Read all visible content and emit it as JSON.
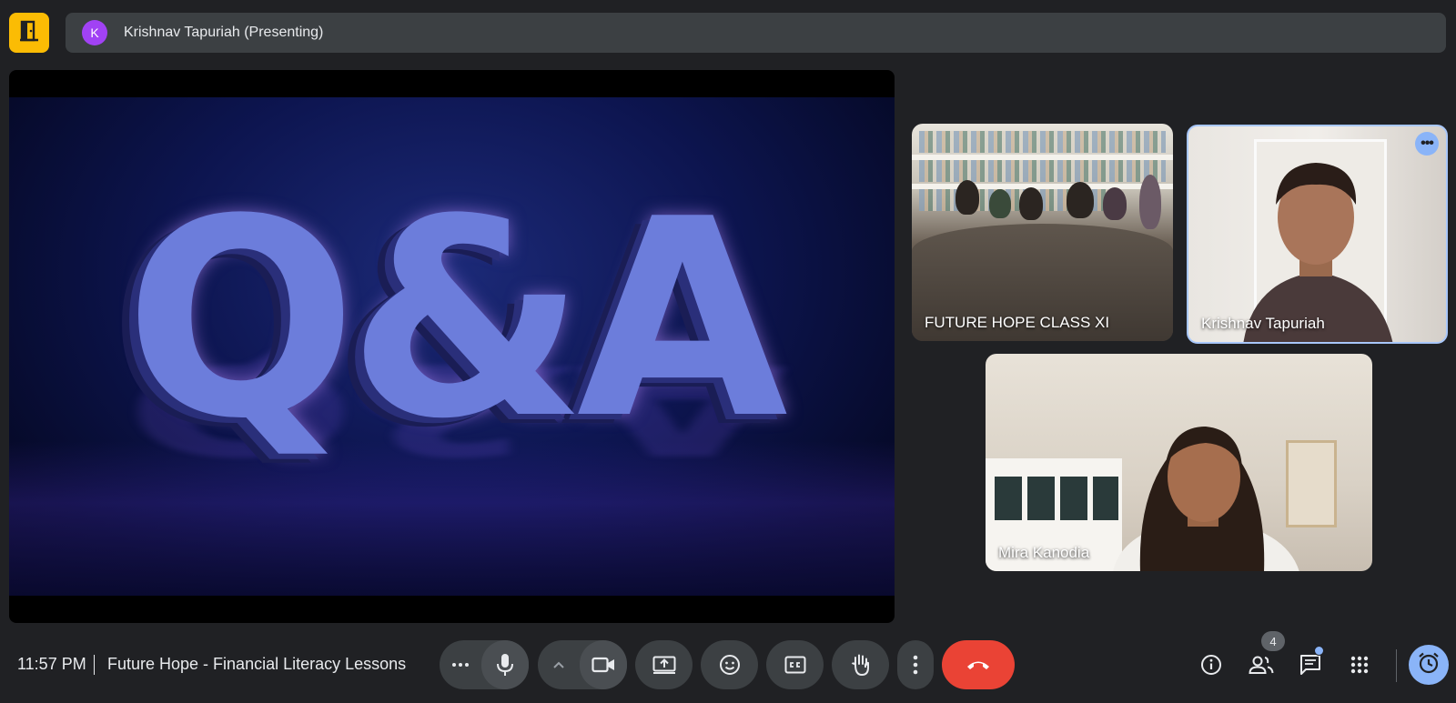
{
  "header": {
    "presenter_initial": "K",
    "presenter_label": "Krishnav Tapuriah (Presenting)",
    "logo_icon": "exit-door-icon"
  },
  "stage": {
    "slide_text": "Q&A"
  },
  "participants": [
    {
      "name": "FUTURE HOPE CLASS XI"
    },
    {
      "name": "Krishnav Tapuriah",
      "active_speaker": true
    },
    {
      "name": "Mira Kanodia"
    }
  ],
  "footer": {
    "time": "11:57 PM",
    "meeting_title": "Future Hope - Financial Literacy Lessons",
    "people_count": "4",
    "controls": [
      "more-mic-options",
      "microphone",
      "more-camera-options",
      "camera",
      "present-screen",
      "reactions",
      "captions",
      "raise-hand",
      "more-options",
      "leave-call"
    ],
    "right_icons": [
      "info",
      "people",
      "chat",
      "activities",
      "host-controls-alarm"
    ]
  },
  "colors": {
    "background": "#202124",
    "surface": "#3c4043",
    "leave": "#ea4335",
    "accent": "#8ab4f8",
    "logo": "#fbbc04",
    "avatar": "#a142f4"
  }
}
